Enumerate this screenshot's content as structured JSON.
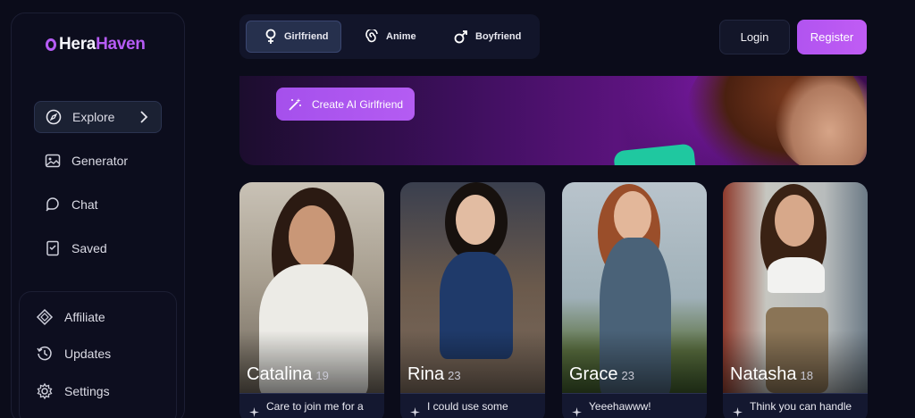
{
  "brand": {
    "part1": "Hera",
    "part2": "Haven"
  },
  "sidebar": {
    "items": [
      {
        "label": "Explore",
        "icon": "compass-icon"
      },
      {
        "label": "Generator",
        "icon": "image-icon"
      },
      {
        "label": "Chat",
        "icon": "chat-icon"
      },
      {
        "label": "Saved",
        "icon": "bookmark-icon"
      }
    ],
    "bottom": [
      {
        "label": "Affiliate",
        "icon": "diamond-icon"
      },
      {
        "label": "Updates",
        "icon": "history-icon"
      },
      {
        "label": "Settings",
        "icon": "gear-icon"
      }
    ]
  },
  "tabs": [
    {
      "label": "Girlfriend",
      "icon": "female-icon"
    },
    {
      "label": "Anime",
      "icon": "spiral-icon"
    },
    {
      "label": "Boyfriend",
      "icon": "male-icon"
    }
  ],
  "auth": {
    "login": "Login",
    "register": "Register"
  },
  "banner": {
    "cta": "Create AI Girlfriend"
  },
  "cards": [
    {
      "name": "Catalina",
      "age": "19",
      "message": "Care to join me for a"
    },
    {
      "name": "Rina",
      "age": "23",
      "message": "I could use some"
    },
    {
      "name": "Grace",
      "age": "23",
      "message": "Yeeehawww!"
    },
    {
      "name": "Natasha",
      "age": "18",
      "message": "Think you can handle"
    }
  ],
  "colors": {
    "accent": "#b65cf5",
    "background": "#0b0c1a"
  }
}
